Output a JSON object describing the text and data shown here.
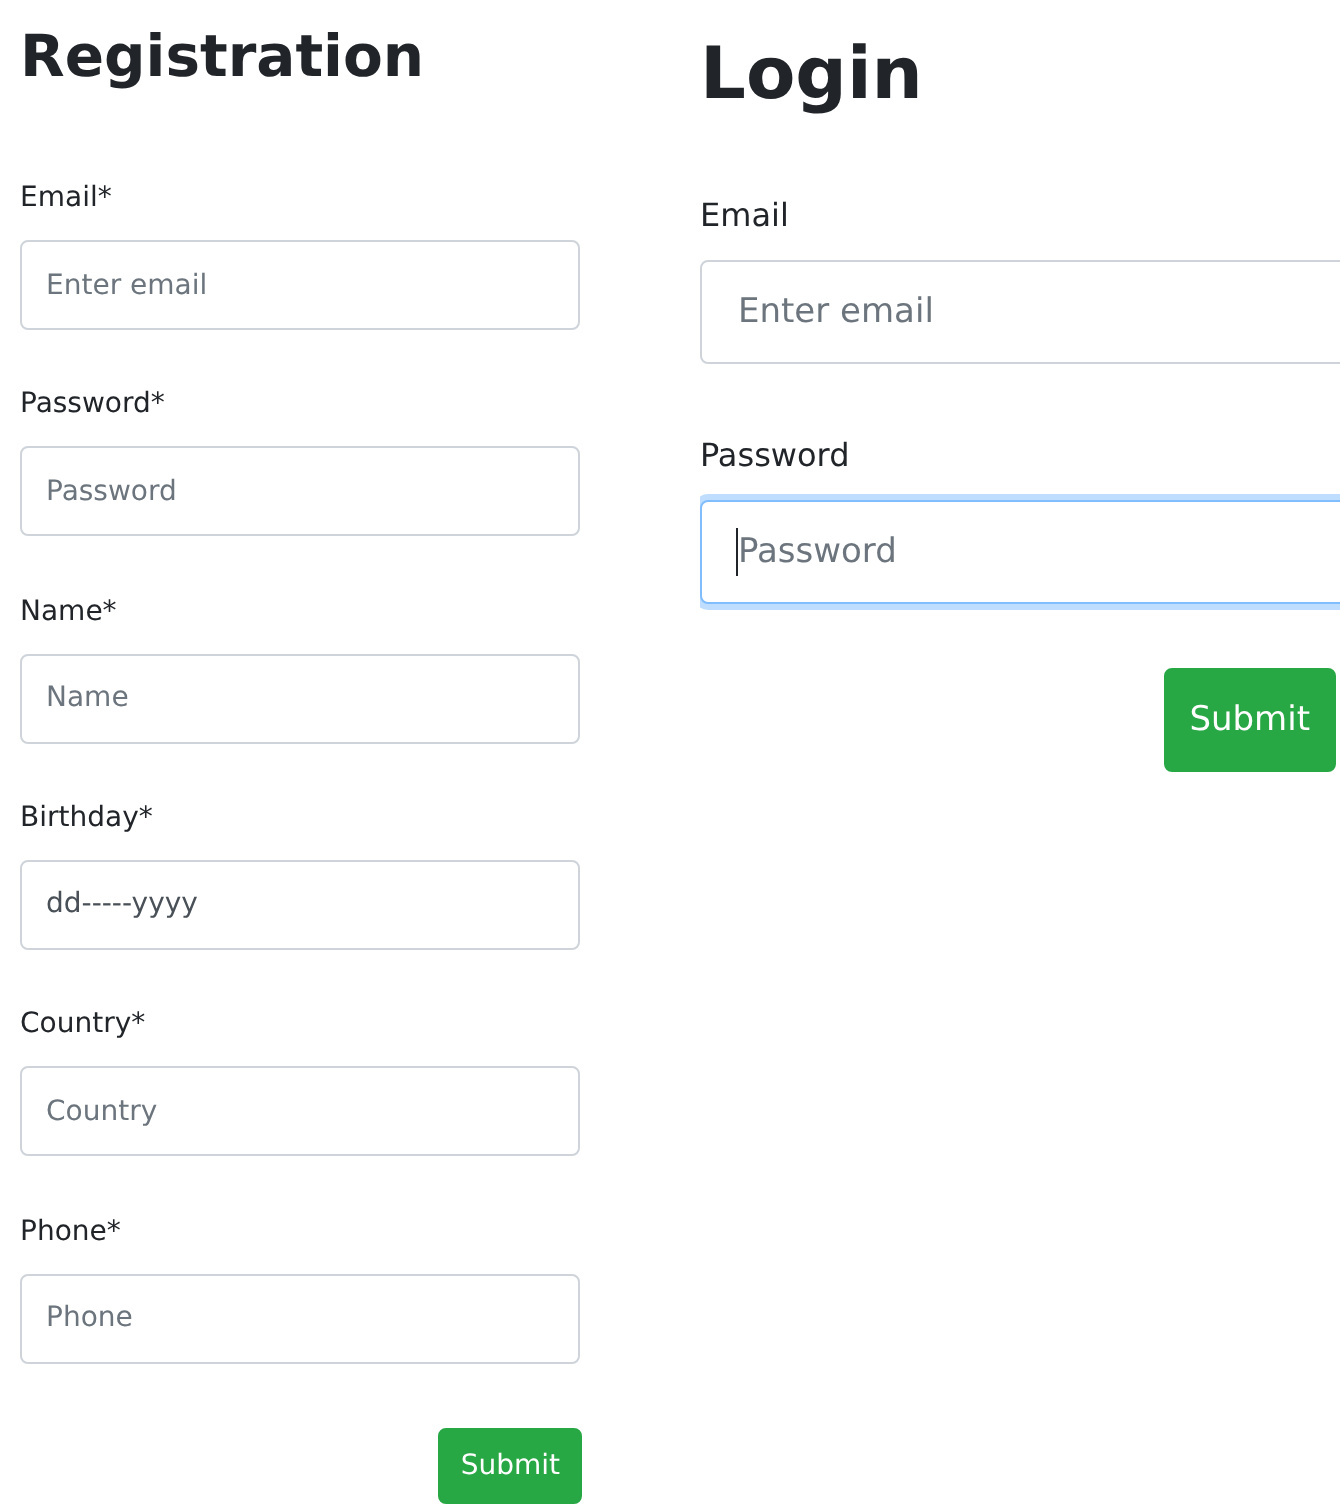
{
  "registration": {
    "title": "Registration",
    "fields": [
      {
        "label": "Email*",
        "placeholder": "Enter email",
        "kind": "text",
        "focused": false
      },
      {
        "label": "Password*",
        "placeholder": "Password",
        "kind": "text",
        "focused": false
      },
      {
        "label": "Name*",
        "placeholder": "Name",
        "kind": "text",
        "focused": false
      },
      {
        "label": "Birthday*",
        "placeholder": "dd-----yyyy",
        "kind": "date",
        "focused": false
      },
      {
        "label": "Country*",
        "placeholder": "Country",
        "kind": "text",
        "focused": false
      },
      {
        "label": "Phone*",
        "placeholder": "Phone",
        "kind": "text",
        "focused": false
      }
    ],
    "button": "Submit"
  },
  "login": {
    "title": "Login",
    "fields": [
      {
        "label": "Email",
        "placeholder": "Enter email",
        "focused": false
      },
      {
        "label": "Password",
        "placeholder": "Password",
        "focused": true
      }
    ],
    "button": "Submit"
  }
}
